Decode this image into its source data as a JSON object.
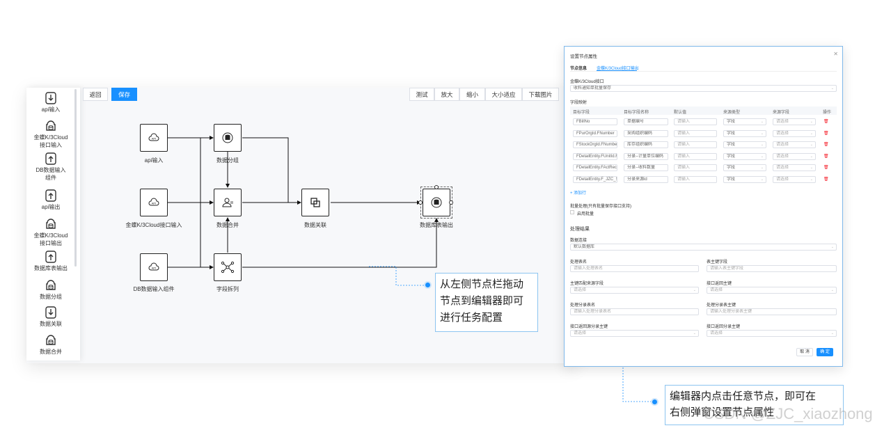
{
  "sidebar": {
    "items": [
      {
        "label": "api输入",
        "icon": "download-icon"
      },
      {
        "label": "金蝶K/3Cloud 接口输入",
        "icon": "database-icon"
      },
      {
        "label": "DB数据输入 组件",
        "icon": "upload-icon"
      },
      {
        "label": "api输出",
        "icon": "upload-icon"
      },
      {
        "label": "金蝶K/3Cloud 接口输出",
        "icon": "database-icon"
      },
      {
        "label": "数据库表输出",
        "icon": "upload-icon"
      },
      {
        "label": "数据分组",
        "icon": "database-icon"
      },
      {
        "label": "数据关联",
        "icon": "download-icon"
      },
      {
        "label": "数据合并",
        "icon": "database-icon"
      }
    ]
  },
  "toolbar": {
    "back": "返回",
    "save": "保存",
    "test": "测试",
    "zoom_in": "放大",
    "zoom_out": "缩小",
    "fit": "大小适应",
    "download": "下载图片"
  },
  "nodes": {
    "api_in": "api输入",
    "k3_in": "金蝶K/3Cloud接口输入",
    "db_in": "DB数据输入组件",
    "group": "数据分组",
    "merge": "数据合并",
    "split": "字段拆列",
    "relate": "数据关联",
    "db_out": "数据库表输出"
  },
  "callouts": {
    "left": [
      "从左侧节点栏拖动",
      "节点到编辑器即可",
      "进行任务配置"
    ],
    "right": [
      "编辑器内点击任意节点，即可在",
      "右侧弹窗设置节点属性"
    ]
  },
  "dialog": {
    "title": "设置节点属性",
    "tab_info": "节点信息",
    "tab_active": "金蝶K/3Cloud接口输出",
    "interface_label": "金蝶K/3Cloud接口",
    "interface_value": "收料通知单批量保存",
    "mapping_label": "字段映射",
    "columns": [
      "目标字段",
      "目标字段名称",
      "默认值",
      "来源类型",
      "来源字段",
      "操作"
    ],
    "rows": [
      {
        "field": "FBillNo",
        "name": "单据编号",
        "default": "请输入",
        "type": "字段",
        "source": "请选择"
      },
      {
        "field": "FPurOrgId.FNumber",
        "name": "采购组织编码",
        "default": "请输入",
        "type": "字段",
        "source": "请选择"
      },
      {
        "field": "FStockOrgId.FNumber",
        "name": "库存组织编码",
        "default": "请输入",
        "type": "字段",
        "source": "请选择"
      },
      {
        "field": "FDetailEntity.FUnitId.Fl",
        "name": "分录--计量单位编码",
        "default": "请输入",
        "type": "字段",
        "source": "请选择"
      },
      {
        "field": "FDetailEntity.FActRecei",
        "name": "分录--收料数量",
        "default": "请输入",
        "type": "字段",
        "source": "请选择"
      },
      {
        "field": "FDetailEntity.F_JZC_So",
        "name": "分录来源id",
        "default": "请输入",
        "type": "字段",
        "source": "请选择"
      }
    ],
    "add_row": "+ 添加行",
    "batch_label": "批量处理(只有批量保存接口支持)",
    "batch_checkbox": "启用批量",
    "result_title": "处理结果",
    "conn_label": "数据连接",
    "conn_value": "默认数据库",
    "table_label": "处理表名",
    "table_placeholder": "请输入处理表名",
    "pk_label": "表主键字段",
    "pk_placeholder": "请输入表主键字段",
    "pk_match_label": "主键匹配来源字段",
    "pk_match_placeholder": "请选择",
    "return_pk_label": "接口返回主键",
    "return_pk_placeholder": "请选择",
    "sub_table_label": "处理分录表名",
    "sub_table_placeholder": "请输入处理分录表名",
    "sub_pk_label": "处理分录表主键",
    "sub_pk_placeholder": "请输入处理分录表主键",
    "return_sub_src_label": "接口返回源分录主键",
    "return_sub_src_placeholder": "请选择",
    "return_sub_label": "接口返回分录主键",
    "return_sub_placeholder": "请选择",
    "cancel": "取 消",
    "confirm": "确 定"
  },
  "watermark": "CSDN @ZJC_xiaozhong"
}
